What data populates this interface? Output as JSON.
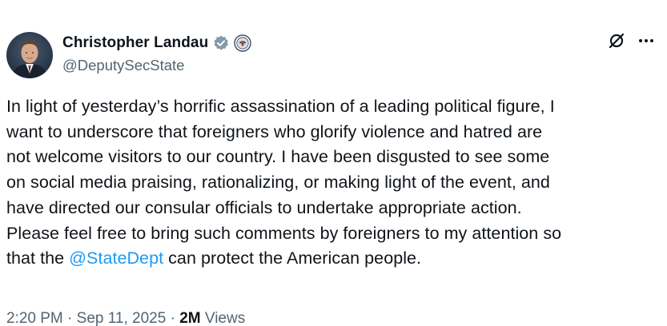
{
  "author": {
    "display_name": "Christopher Landau",
    "handle": "@DeputySecState",
    "verified_icon": "gray-verified-badge-icon",
    "affiliation_icon": "government-seal-icon"
  },
  "actions": {
    "grok_icon": "grok-icon",
    "more_icon": "more-options-icon"
  },
  "tweet": {
    "lines": [
      "In light of yesterday’s horrific assassination of a leading political figure, I",
      "want to underscore that foreigners who glorify violence and hatred are",
      "not welcome visitors to our country. I have been disgusted to see some",
      "on social media praising, rationalizing, or making light of the event, and",
      "have directed our consular officials to undertake appropriate action.",
      "Please feel free to bring such comments by foreigners to my attention so"
    ],
    "last_line_before": "that the ",
    "mention": "@StateDept",
    "last_line_after": " can protect the American people."
  },
  "meta": {
    "time": "2:20 PM",
    "separator": " · ",
    "date": "Sep 11, 2025",
    "views_count": "2M",
    "views_label": " Views"
  },
  "colors": {
    "text": "#0f1419",
    "secondary": "#536471",
    "link": "#1d9bf0",
    "verified_gray": "#829aab"
  }
}
